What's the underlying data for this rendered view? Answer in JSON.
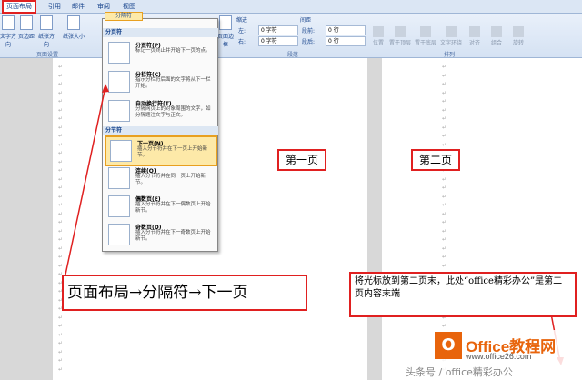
{
  "tabs": [
    "页面布局",
    "引用",
    "邮件",
    "审阅",
    "视图"
  ],
  "ribbon": {
    "buttons": [
      "文字方向",
      "页边距",
      "纸张方向",
      "纸张大小"
    ],
    "breaks_button": "分隔符",
    "page_setup_label": "页面设置",
    "page_border": "页面边框",
    "indent_label": "缩进",
    "spacing_label": "间距",
    "indent_left_label": "左:",
    "indent_left_value": "0 字符",
    "indent_right_label": "右:",
    "indent_right_value": "0 字符",
    "space_before_label": "段前:",
    "space_before_value": "0 行",
    "space_after_label": "段后:",
    "space_after_value": "0 行",
    "paragraph_label": "段落",
    "arrange_buttons": [
      "位置",
      "置于顶层",
      "置于底层",
      "文字环绕",
      "对齐",
      "组合",
      "旋转"
    ],
    "arrange_label": "排列"
  },
  "menu": {
    "section_page_breaks": "分页符",
    "section_section_breaks": "分节符",
    "items": [
      {
        "title": "分页符(P)",
        "desc": "标记一页终止并开始下一页的点。"
      },
      {
        "title": "分栏符(C)",
        "desc": "指示分栏符后面的文字将从下一栏开始。"
      },
      {
        "title": "自动换行符(T)",
        "desc": "分隔网页上的对象周围的文字，如分隔题注文字与正文。"
      },
      {
        "title": "下一页(N)",
        "desc": "插入分节符并在下一页上开始新节。"
      },
      {
        "title": "连续(O)",
        "desc": "插入分节符并在同一页上开始新节。"
      },
      {
        "title": "偶数页(E)",
        "desc": "插入分节符并在下一偶数页上开始新节。"
      },
      {
        "title": "奇数页(D)",
        "desc": "插入分节符并在下一奇数页上开始新节。"
      }
    ]
  },
  "annotations": {
    "callout": "页面布局→分隔符→下一页",
    "page1": "第一页",
    "page2": "第二页",
    "note": "将光标放到第二页末，此处“office精彩办公”是第二页内容末端"
  },
  "watermark": {
    "brand": "Office教程网",
    "url": "www.office26.com",
    "credit": "头条号 / office精彩办公"
  },
  "paragraph_mark": "↵"
}
